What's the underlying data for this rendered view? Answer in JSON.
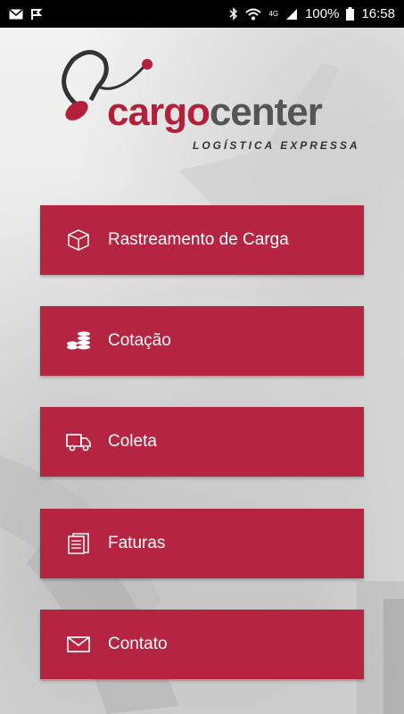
{
  "status": {
    "battery": "100%",
    "time": "16:58",
    "network": "4G"
  },
  "brand": {
    "name_part1": "cargo",
    "name_part2": "center",
    "tagline": "LOGÍSTICA EXPRESSA",
    "accent": "#b41f3a"
  },
  "menu": {
    "items": [
      {
        "label": "Rastreamento de Carga",
        "icon": "box-icon"
      },
      {
        "label": "Cotação",
        "icon": "coins-icon"
      },
      {
        "label": "Coleta",
        "icon": "truck-icon"
      },
      {
        "label": "Faturas",
        "icon": "invoice-icon"
      },
      {
        "label": "Contato",
        "icon": "envelope-icon"
      }
    ],
    "button_color": "#b52440"
  }
}
